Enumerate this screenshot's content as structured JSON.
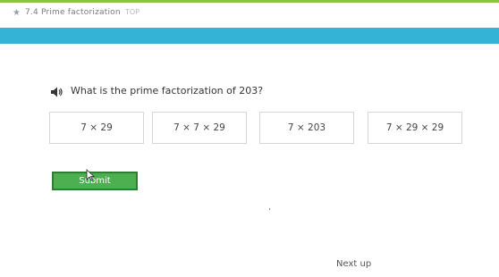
{
  "header": {
    "star_icon": "star-icon",
    "title": "7.4 Prime factorization",
    "status": "TOP"
  },
  "question": {
    "audio_icon": "speaker-icon",
    "text": "What is the prime factorization of 203?"
  },
  "choices": [
    {
      "label": "7 × 29"
    },
    {
      "label": "7 × 7 × 29"
    },
    {
      "label": "7 × 203"
    },
    {
      "label": "7 × 29 × 29"
    }
  ],
  "submit": {
    "label": "Submit"
  },
  "next_up": {
    "label": "Next up"
  },
  "colors": {
    "accent_green": "#4caf50",
    "band_blue": "#34b3d6",
    "top_strip": "#8bc34a"
  }
}
